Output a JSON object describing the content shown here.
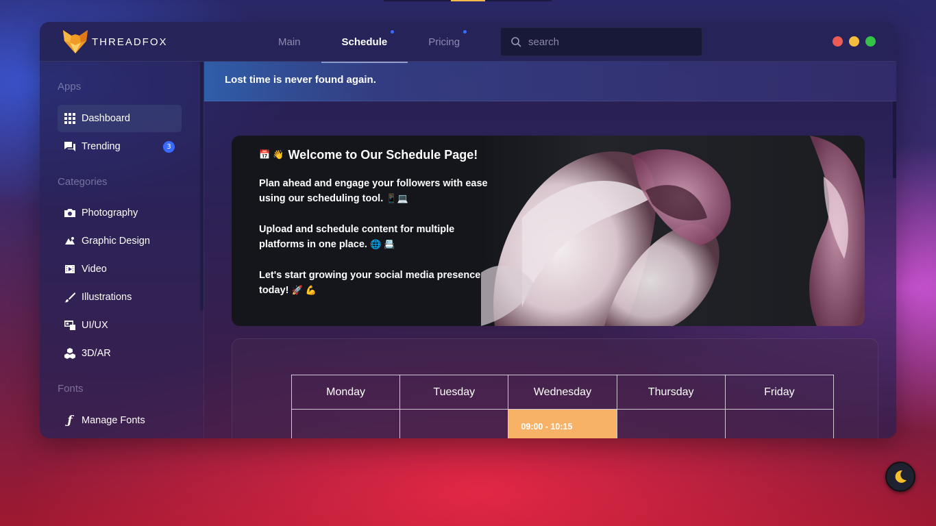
{
  "app": {
    "brand": "THREADFOX"
  },
  "header": {
    "tabs": [
      {
        "label": "Main",
        "active": false,
        "dot": false
      },
      {
        "label": "Schedule",
        "active": true,
        "dot": true
      },
      {
        "label": "Pricing",
        "active": false,
        "dot": true
      }
    ],
    "search_placeholder": "search",
    "window_controls": [
      "#ec5b56",
      "#f5bd3c",
      "#35c248"
    ]
  },
  "sidebar": {
    "apps_title": "Apps",
    "apps": [
      {
        "label": "Dashboard",
        "icon": "grid-icon",
        "active": true
      },
      {
        "label": "Trending",
        "icon": "chat-icon",
        "badge": "3"
      }
    ],
    "categories_title": "Categories",
    "categories": [
      {
        "label": "Photography",
        "icon": "camera-icon"
      },
      {
        "label": "Graphic Design",
        "icon": "design-icon"
      },
      {
        "label": "Video",
        "icon": "video-icon"
      },
      {
        "label": "Illustrations",
        "icon": "brush-icon"
      },
      {
        "label": "UI/UX",
        "icon": "uiux-icon"
      },
      {
        "label": "3D/AR",
        "icon": "cubes-icon"
      }
    ],
    "fonts_title": "Fonts",
    "fonts": [
      {
        "label": "Manage Fonts",
        "icon": "font-icon"
      }
    ]
  },
  "main": {
    "quote": "Lost time is never found again.",
    "welcome": {
      "title_emoji": "📅 👋",
      "title": "Welcome to Our Schedule Page!",
      "p1": "Plan ahead and engage your followers with ease using our scheduling tool.",
      "p1_emoji": "📱💻",
      "p2": "Upload and schedule content for multiple platforms in one place.",
      "p2_emoji": "🌐 📇",
      "p3": "Let's start growing your social media presence today!",
      "p3_emoji": "🚀 💪"
    },
    "schedule": {
      "days": [
        "Monday",
        "Tuesday",
        "Wednesday",
        "Thursday",
        "Friday"
      ],
      "event": {
        "day": "Wednesday",
        "time": "09:00 - 10:15",
        "color": "#f7b267"
      }
    }
  },
  "colors": {
    "accent": "#3a6bff",
    "event": "#f7b267"
  }
}
